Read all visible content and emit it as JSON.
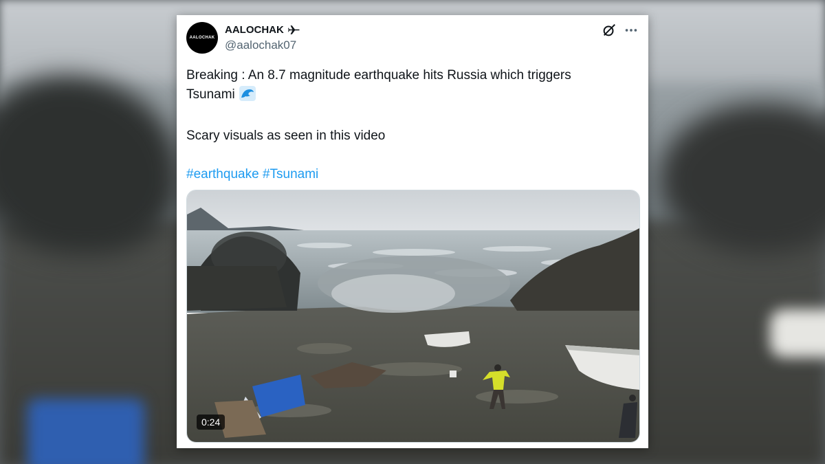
{
  "tweet": {
    "avatar_text": "AALOCHAK",
    "display_name": "AALOCHAK",
    "handle": "@aalochak07",
    "text_line1": "Breaking : An 8.7 magnitude earthquake hits Russia which triggers",
    "text_line2": "Tsunami",
    "text_line3": "Scary visuals as seen in this video",
    "hashtags": [
      "#earthquake",
      "#Tsunami"
    ],
    "video_duration": "0:24"
  },
  "icons": {
    "name_badge": "airplane-icon",
    "grok": "grok-icon",
    "more": "more-options-icon",
    "emoji": "water-wave-icon"
  },
  "colors": {
    "text": "#0f1419",
    "secondary": "#536471",
    "link": "#1d9bf0",
    "card": "#ffffff"
  }
}
